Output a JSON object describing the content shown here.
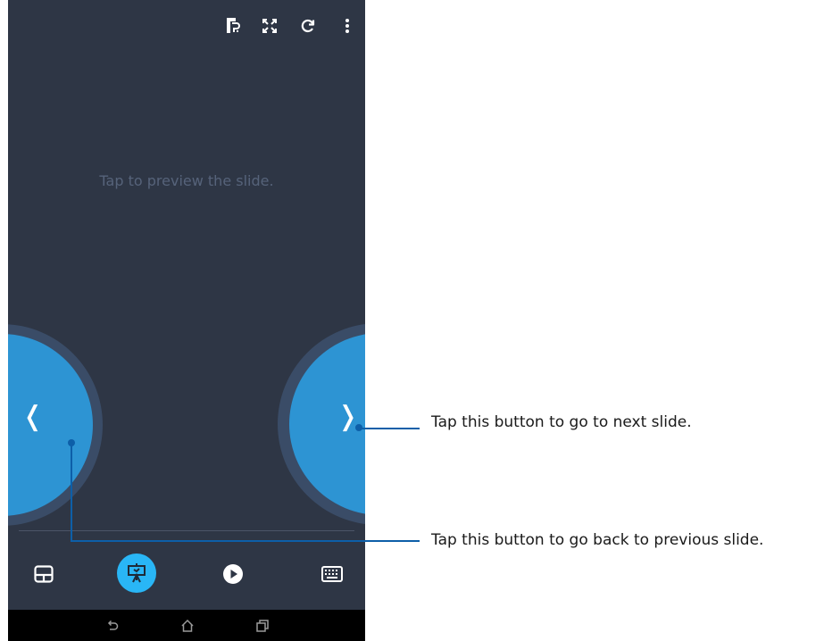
{
  "screen": {
    "preview_hint": "Tap to preview the slide.",
    "toolbar_icons": [
      "pptx-file-icon",
      "fullscreen-icon",
      "refresh-icon",
      "overflow-menu-icon"
    ],
    "prev_glyph": "❬",
    "next_glyph": "❭",
    "bottom_bar_icons": [
      "touchpad-icon",
      "presentation-icon",
      "play-icon",
      "keyboard-icon"
    ],
    "nav_icons": [
      "back-icon",
      "home-icon",
      "recents-icon"
    ]
  },
  "callouts": {
    "next": "Tap this button to go to next slide.",
    "previous": "Tap this button to go back to previous slide."
  },
  "colors": {
    "background": "#2e3645",
    "accent_blue": "#2d94d3",
    "active_icon": "#29b6f6",
    "callout_line": "#0d5fa8"
  }
}
